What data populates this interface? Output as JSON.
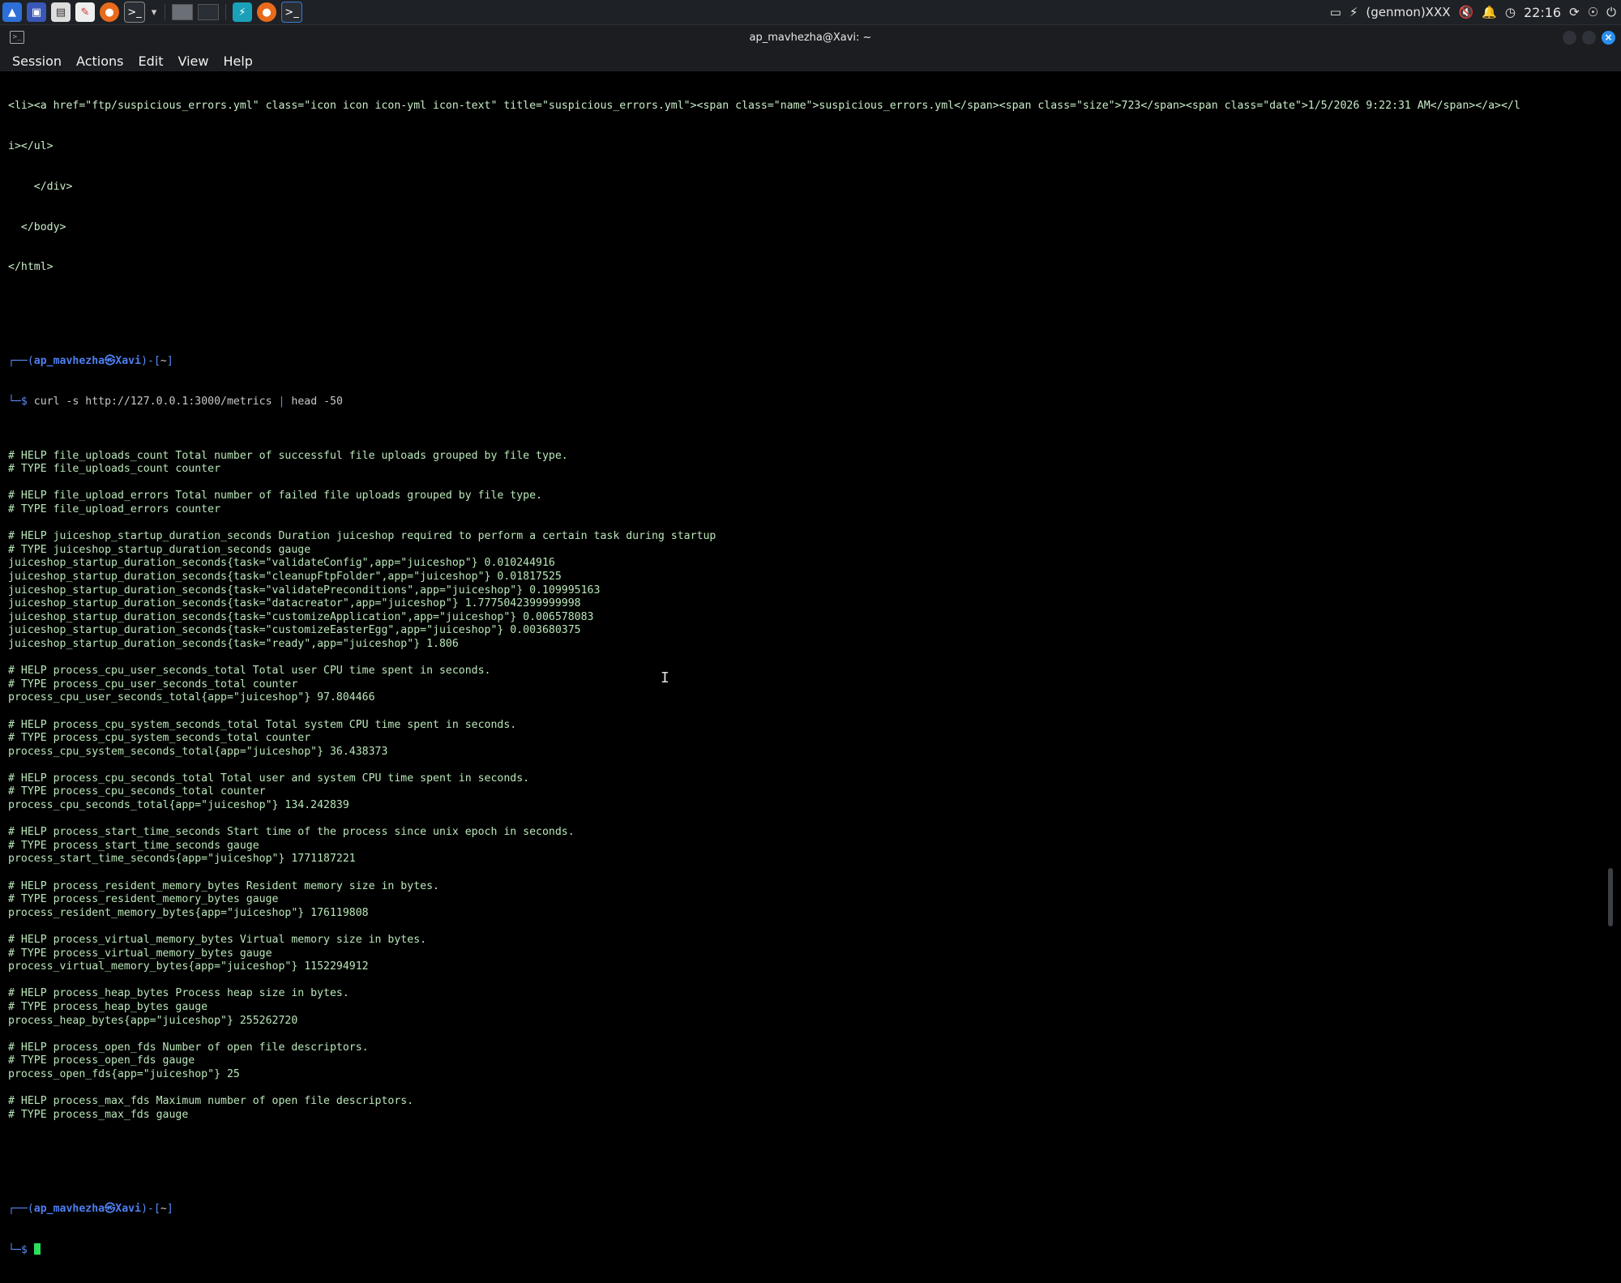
{
  "taskbar": {
    "app_icons": [
      "kali-menu-icon",
      "show-desktop-icon",
      "file-manager-icon",
      "text-editor-icon",
      "firefox-icon",
      "terminal-icon"
    ],
    "right": {
      "genmon_label": "(genmon)XXX",
      "clock": "22:16"
    }
  },
  "window": {
    "title": "ap_mavhezha@Xavi: ~",
    "menu": [
      "Session",
      "Actions",
      "Edit",
      "View",
      "Help"
    ]
  },
  "terminal": {
    "html_tail": [
      "<li><a href=\"ftp/suspicious_errors.yml\" class=\"icon icon icon-yml icon-text\" title=\"suspicious_errors.yml\"><span class=\"name\">suspicious_errors.yml</span><span class=\"size\">723</span><span class=\"date\">1/5/2026 9:22:31 AM</span></a></l",
      "i></ul>",
      "    </div>",
      "  </body>",
      "</html>"
    ],
    "prompt_user": "ap_mavhezha",
    "prompt_at": "㉿",
    "prompt_host": "Xavi",
    "prompt_dir": "~",
    "command": "curl -s http://127.0.0.1:3000/metrics",
    "pipe": "|",
    "command_tail": "head -50",
    "output": [
      "# HELP file_uploads_count Total number of successful file uploads grouped by file type.",
      "# TYPE file_uploads_count counter",
      "",
      "# HELP file_upload_errors Total number of failed file uploads grouped by file type.",
      "# TYPE file_upload_errors counter",
      "",
      "# HELP juiceshop_startup_duration_seconds Duration juiceshop required to perform a certain task during startup",
      "# TYPE juiceshop_startup_duration_seconds gauge",
      "juiceshop_startup_duration_seconds{task=\"validateConfig\",app=\"juiceshop\"} 0.010244916",
      "juiceshop_startup_duration_seconds{task=\"cleanupFtpFolder\",app=\"juiceshop\"} 0.01817525",
      "juiceshop_startup_duration_seconds{task=\"validatePreconditions\",app=\"juiceshop\"} 0.109995163",
      "juiceshop_startup_duration_seconds{task=\"datacreator\",app=\"juiceshop\"} 1.7775042399999998",
      "juiceshop_startup_duration_seconds{task=\"customizeApplication\",app=\"juiceshop\"} 0.006578083",
      "juiceshop_startup_duration_seconds{task=\"customizeEasterEgg\",app=\"juiceshop\"} 0.003680375",
      "juiceshop_startup_duration_seconds{task=\"ready\",app=\"juiceshop\"} 1.806",
      "",
      "# HELP process_cpu_user_seconds_total Total user CPU time spent in seconds.",
      "# TYPE process_cpu_user_seconds_total counter",
      "process_cpu_user_seconds_total{app=\"juiceshop\"} 97.804466",
      "",
      "# HELP process_cpu_system_seconds_total Total system CPU time spent in seconds.",
      "# TYPE process_cpu_system_seconds_total counter",
      "process_cpu_system_seconds_total{app=\"juiceshop\"} 36.438373",
      "",
      "# HELP process_cpu_seconds_total Total user and system CPU time spent in seconds.",
      "# TYPE process_cpu_seconds_total counter",
      "process_cpu_seconds_total{app=\"juiceshop\"} 134.242839",
      "",
      "# HELP process_start_time_seconds Start time of the process since unix epoch in seconds.",
      "# TYPE process_start_time_seconds gauge",
      "process_start_time_seconds{app=\"juiceshop\"} 1771187221",
      "",
      "# HELP process_resident_memory_bytes Resident memory size in bytes.",
      "# TYPE process_resident_memory_bytes gauge",
      "process_resident_memory_bytes{app=\"juiceshop\"} 176119808",
      "",
      "# HELP process_virtual_memory_bytes Virtual memory size in bytes.",
      "# TYPE process_virtual_memory_bytes gauge",
      "process_virtual_memory_bytes{app=\"juiceshop\"} 1152294912",
      "",
      "# HELP process_heap_bytes Process heap size in bytes.",
      "# TYPE process_heap_bytes gauge",
      "process_heap_bytes{app=\"juiceshop\"} 255262720",
      "",
      "# HELP process_open_fds Number of open file descriptors.",
      "# TYPE process_open_fds gauge",
      "process_open_fds{app=\"juiceshop\"} 25",
      "",
      "# HELP process_max_fds Maximum number of open file descriptors.",
      "# TYPE process_max_fds gauge"
    ]
  },
  "colors": {
    "output_text": "#b9e6b9",
    "prompt_user": "#4f7ff0",
    "cursor": "#28e05a",
    "close_button": "#2b8ff0"
  }
}
